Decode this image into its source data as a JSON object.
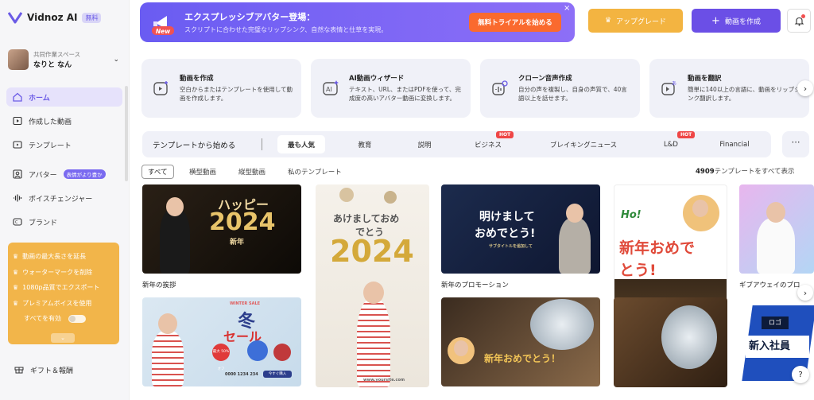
{
  "app": {
    "name": "Vidnoz AI",
    "badge": "無料"
  },
  "workspace": {
    "label": "共同作業スペース",
    "name": "なりと なん"
  },
  "nav": [
    {
      "label": "ホーム",
      "icon": "home-icon",
      "active": true
    },
    {
      "label": "作成した動画",
      "icon": "video-icon"
    },
    {
      "label": "テンプレート",
      "icon": "template-icon"
    },
    {
      "label": "アバター",
      "icon": "avatar-icon",
      "badge": "表情がより豊か"
    },
    {
      "label": "ボイスチェンジャー",
      "icon": "waveform-icon"
    },
    {
      "label": "ブランド",
      "icon": "brand-icon"
    }
  ],
  "premium": {
    "items": [
      "動画の最大長さを延長",
      "ウォーターマークを削除",
      "1080p品質でエクスポート",
      "プレミアムボイスを使用"
    ],
    "enable_all": "すべてを有効",
    "expand": "⌄"
  },
  "gift": "ギフト＆報酬",
  "banner": {
    "tag": "New",
    "title": "エクスプレッシブアバター登場：",
    "subtitle": "スクリプトに合わせた完璧なリップシンク、自然な表情と仕草を実現。",
    "cta": "無料トライアルを始める",
    "close": "×"
  },
  "header": {
    "upgrade": "アップグレード",
    "create": "動画を作成"
  },
  "features": [
    {
      "title": "動画を作成",
      "desc": "空白からまたはテンプレートを使用して動画を作成します。",
      "icon": "video-plus-icon"
    },
    {
      "title": "AI動画ウィザード",
      "desc": "テキスト、URL、またはPDFを使って、完成度の高いアバター動画に変換します。",
      "icon": "ai-icon"
    },
    {
      "title": "クローン音声作成",
      "desc": "自分の声を複製し、自身の声質で、40言語以上を話せます。",
      "icon": "voice-clone-icon"
    },
    {
      "title": "動画を翻訳",
      "desc": "簡単に140以上の言語に、動画をリップシンク翻訳します。",
      "icon": "translate-icon"
    }
  ],
  "tabs": {
    "heading": "テンプレートから始める",
    "items": [
      {
        "label": "最も人気",
        "active": true
      },
      {
        "label": "教育"
      },
      {
        "label": "説明"
      },
      {
        "label": "ビジネス",
        "hot": "HOT"
      },
      {
        "label": "ブレイキングニュース"
      },
      {
        "label": "L&D",
        "hot": "HOT"
      },
      {
        "label": "Financial"
      }
    ],
    "more": "⋯"
  },
  "subtabs": [
    "すべて",
    "横型動画",
    "縦型動画",
    "私のテンプレート"
  ],
  "count": {
    "number": "4909",
    "text": "テンプレートをすべて表示"
  },
  "templates": {
    "t1": {
      "caption": "新年の挨拶",
      "line1": "ハッピー",
      "line2": "2024",
      "line3": "新年"
    },
    "t2": {
      "line1": "あけましておめ",
      "line2": "でとう",
      "line3": "2024",
      "url": "www.yoursite.com"
    },
    "t3": {
      "caption": "新年のプロモーション",
      "line1": "明けまして",
      "line2": "おめでとう!",
      "sub": "サブタイトルを追加して"
    },
    "t4": {
      "line0": "Ho!",
      "line1": "新年おめで",
      "line2": "とう!"
    },
    "t5": {
      "caption": "ギブアウェイのプロ"
    },
    "t6": {
      "line0": "WINTER SALE",
      "line1": "冬",
      "line2": "セール",
      "btn": "今すぐ購入",
      "phone": "0000 1234 234",
      "pct": "最大 50% オフ"
    },
    "t8": {
      "line1": "新年おめでとう！"
    },
    "t10": {
      "line0": "ロゴ",
      "line1": "新入社員"
    }
  }
}
